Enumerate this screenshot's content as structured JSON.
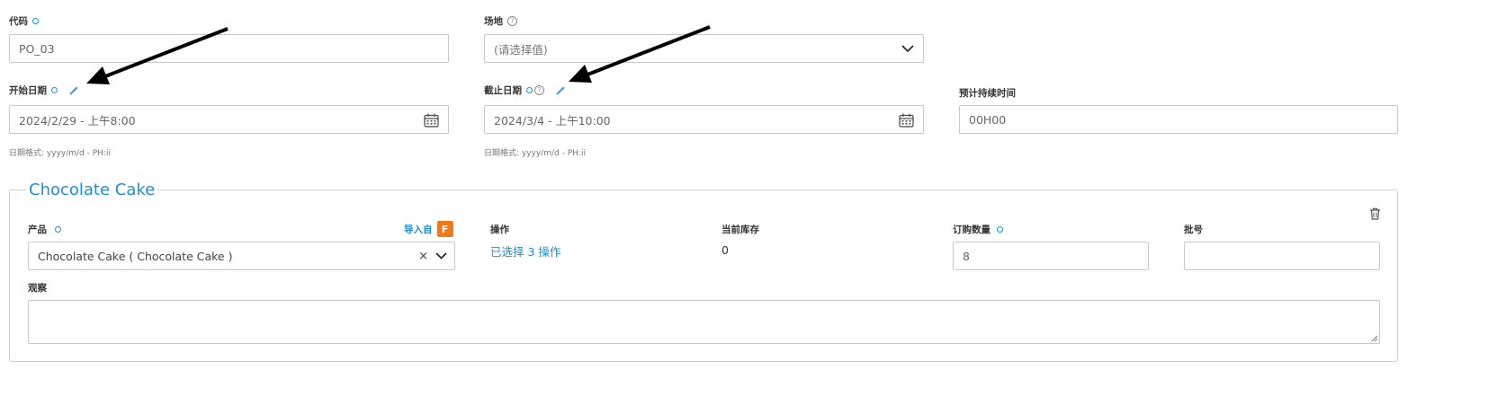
{
  "code": {
    "label": "代码",
    "value": "PO_03"
  },
  "site": {
    "label": "场地",
    "placeholder": "(请选择值)"
  },
  "start_date": {
    "label": "开始日期",
    "value": "2024/2/29 - 上午8:00",
    "hint": "日期格式: yyyy/m/d - PH:ii"
  },
  "end_date": {
    "label": "截止日期",
    "value": "2024/3/4 - 上午10:00",
    "hint": "日期格式: yyyy/m/d - PH:ii"
  },
  "duration": {
    "label": "预计持续时间",
    "value": "00H00"
  },
  "section": {
    "legend": "Chocolate Cake",
    "product": {
      "label": "产品",
      "import_label": "导入自",
      "value": "Chocolate Cake ( Chocolate Cake )"
    },
    "operations": {
      "label": "操作",
      "value": "已选择 3 操作"
    },
    "stock": {
      "label": "当前库存",
      "value": "0"
    },
    "quantity": {
      "label": "订购数量",
      "value": "8"
    },
    "batch": {
      "label": "批号",
      "value": ""
    },
    "observe": {
      "label": "观察",
      "value": ""
    }
  },
  "colors": {
    "accent": "#1e8fd6",
    "border": "#c7c7c7",
    "import_badge": "#f07a1a"
  },
  "icons": [
    "required-dot-icon",
    "help-icon",
    "magic-wand-icon",
    "calendar-icon",
    "chevron-down-icon",
    "clear-icon",
    "trash-icon",
    "import-f-icon",
    "arrow-annotation"
  ]
}
